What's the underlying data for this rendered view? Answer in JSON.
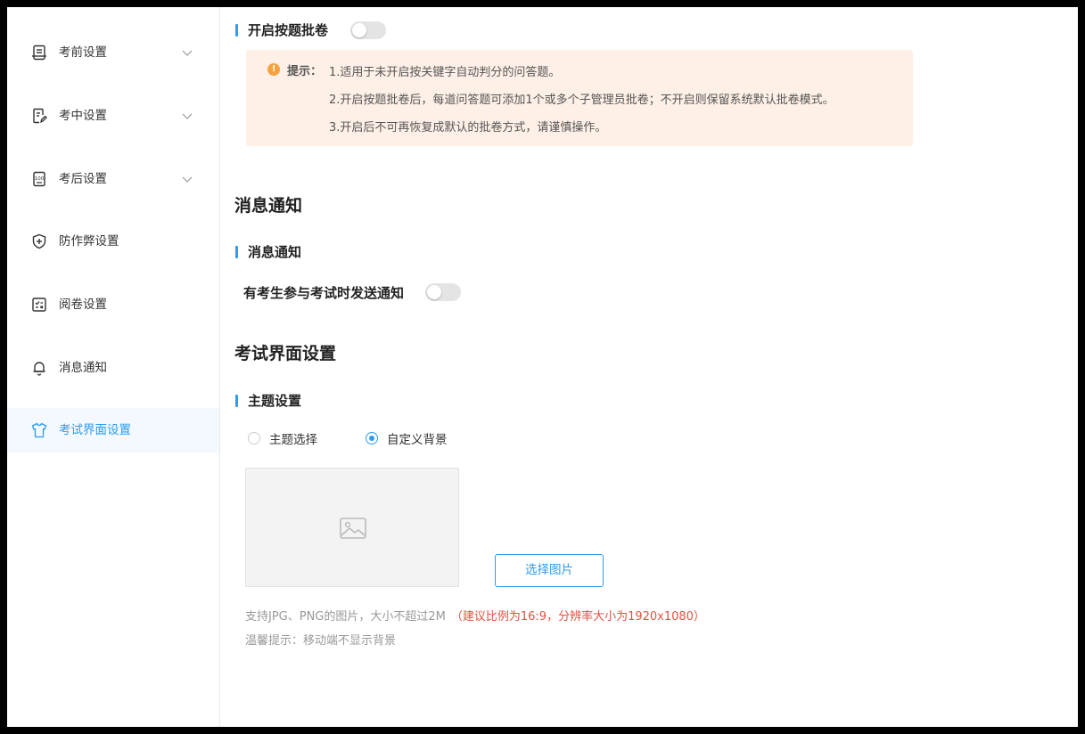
{
  "sidebar": {
    "items": [
      {
        "label": "考前设置",
        "icon": "document-list-icon",
        "has_chevron": true
      },
      {
        "label": "考中设置",
        "icon": "document-edit-icon",
        "has_chevron": true
      },
      {
        "label": "考后设置",
        "icon": "score-sheet-icon",
        "has_chevron": true
      },
      {
        "label": "防作弊设置",
        "icon": "shield-plus-icon",
        "has_chevron": false
      },
      {
        "label": "阅卷设置",
        "icon": "grading-icon",
        "has_chevron": false
      },
      {
        "label": "消息通知",
        "icon": "bell-icon",
        "has_chevron": false
      },
      {
        "label": "考试界面设置",
        "icon": "tshirt-icon",
        "has_chevron": false,
        "active": true
      }
    ]
  },
  "grading": {
    "toggle_label": "开启按题批卷",
    "toggle_on": false,
    "tip": {
      "label": "提示：",
      "icon_glyph": "!",
      "lines": [
        "1.适用于未开启按关键字自动判分的问答题。",
        "2.开启按题批卷后，每道问答题可添加1个或多个子管理员批卷；不开启则保留系统默认批卷模式。",
        "3.开启后不可再恢复成默认的批卷方式，请谨慎操作。"
      ]
    }
  },
  "notify": {
    "section_title": "消息通知",
    "sub_title": "消息通知",
    "toggle_label": "有考生参与考试时发送通知",
    "toggle_on": false
  },
  "ui_settings": {
    "section_title": "考试界面设置",
    "sub_title": "主题设置",
    "radio_options": [
      {
        "label": "主题选择",
        "checked": false
      },
      {
        "label": "自定义背景",
        "checked": true
      }
    ],
    "choose_image_label": "选择图片",
    "hint_text": "支持JPG、PNG的图片，大小不超过2M",
    "hint_warn": "（建议比例为16:9，分辨率大小为1920x1080）",
    "tip_text": "温馨提示：移动端不显示背景"
  },
  "colors": {
    "accent": "#2e9bf0",
    "tip_bg": "#fef0e6",
    "tip_icon": "#f5a340",
    "warn_text": "#e0533e"
  }
}
